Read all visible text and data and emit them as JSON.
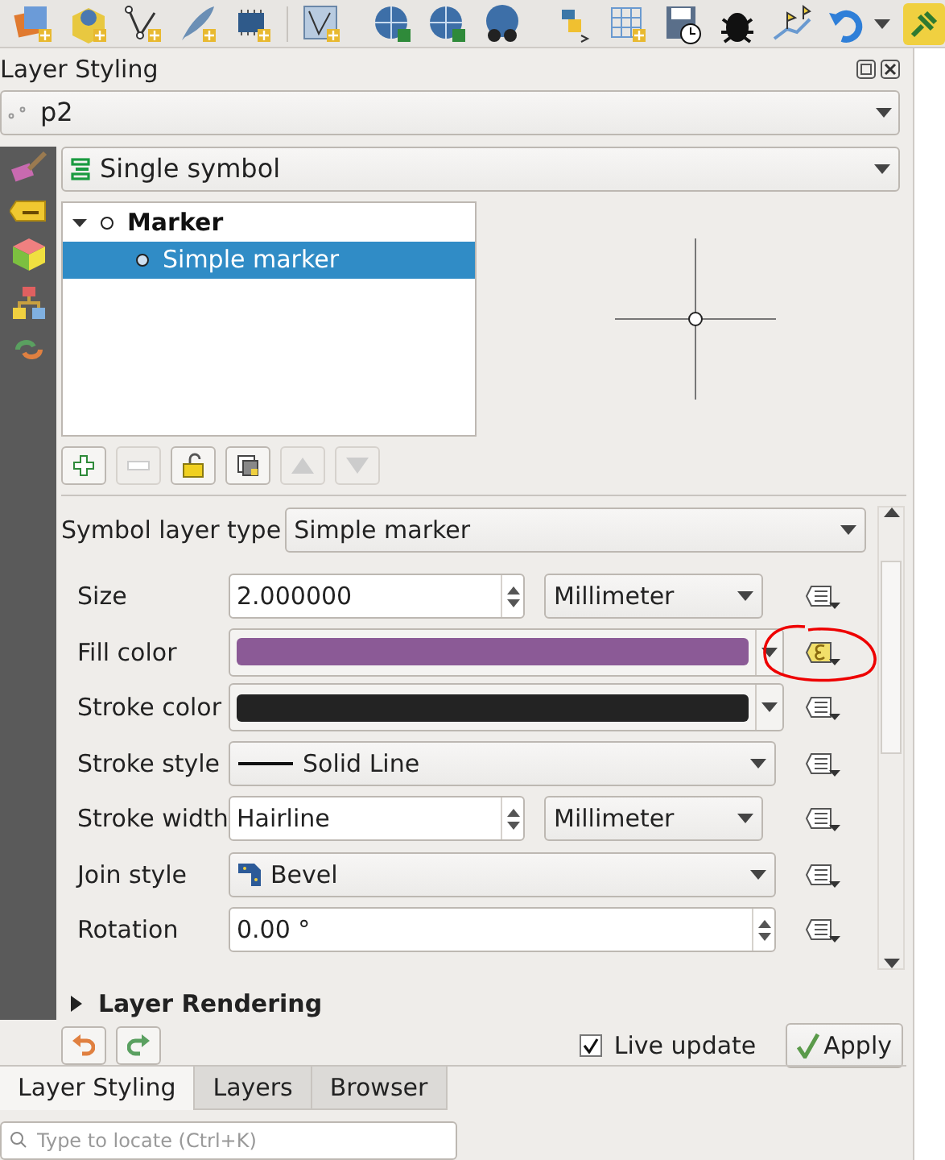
{
  "panel": {
    "title": "Layer Styling"
  },
  "layer_select": {
    "value": "p2"
  },
  "renderer_select": {
    "value": "Single symbol"
  },
  "symbol_tree": [
    {
      "label": "Marker",
      "expanded": true,
      "selected": false,
      "children": [
        {
          "label": "Simple marker",
          "selected": true
        }
      ]
    }
  ],
  "symbol_layer_type": {
    "label": "Symbol layer type",
    "value": "Simple marker"
  },
  "properties": [
    {
      "kind": "spin_unit",
      "label": "Size",
      "value": "2.000000",
      "unit": "Millimeter",
      "data_defined": false
    },
    {
      "kind": "color",
      "label": "Fill color",
      "color": "#8b5a96",
      "data_defined": true
    },
    {
      "kind": "color",
      "label": "Stroke color",
      "color": "#232323",
      "data_defined": false
    },
    {
      "kind": "line_combo",
      "label": "Stroke style",
      "value": "Solid Line",
      "data_defined": false
    },
    {
      "kind": "spin_unit",
      "label": "Stroke width",
      "value": "Hairline",
      "unit": "Millimeter",
      "data_defined": false
    },
    {
      "kind": "icon_combo",
      "label": "Join style",
      "value": "Bevel",
      "data_defined": false
    },
    {
      "kind": "spin",
      "label": "Rotation",
      "value": "0.00 °",
      "data_defined": false
    }
  ],
  "section": {
    "label": "Layer Rendering",
    "expanded": false
  },
  "live_update": {
    "label": "Live update",
    "checked": true
  },
  "apply_button": {
    "label": "Apply"
  },
  "tabs": [
    {
      "label": "Layer Styling",
      "selected": true
    },
    {
      "label": "Layers",
      "selected": false
    },
    {
      "label": "Browser",
      "selected": false
    }
  ],
  "search": {
    "placeholder": "Type to locate (Ctrl+K)"
  }
}
